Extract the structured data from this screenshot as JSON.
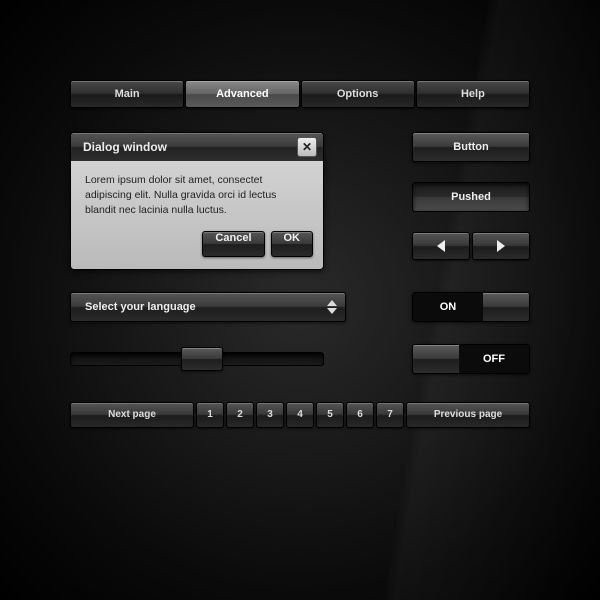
{
  "tabs": [
    "Main",
    "Advanced",
    "Options",
    "Help"
  ],
  "dialog": {
    "title": "Dialog window",
    "body": "Lorem ipsum dolor sit amet, consectet adipiscing elit. Nulla gravida orci id lectus blandit nec lacinia nulla luctus.",
    "cancel": "Cancel",
    "ok": "OK"
  },
  "buttons": {
    "normal": "Button",
    "pushed": "Pushed"
  },
  "dropdown": {
    "label": "Select your language"
  },
  "toggles": {
    "on": "ON",
    "off": "OFF"
  },
  "pagination": {
    "next": "Next page",
    "prev": "Previous page",
    "pages": [
      "1",
      "2",
      "3",
      "4",
      "5",
      "6",
      "7"
    ]
  }
}
